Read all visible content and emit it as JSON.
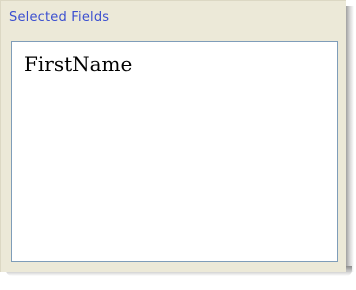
{
  "panel": {
    "title": "Selected Fields",
    "items": [
      {
        "label": "FirstName"
      }
    ]
  },
  "colors": {
    "panel_background": "#ece9d8",
    "title_text": "#3b4fd0",
    "list_border": "#7f9db9",
    "list_background": "#ffffff"
  }
}
